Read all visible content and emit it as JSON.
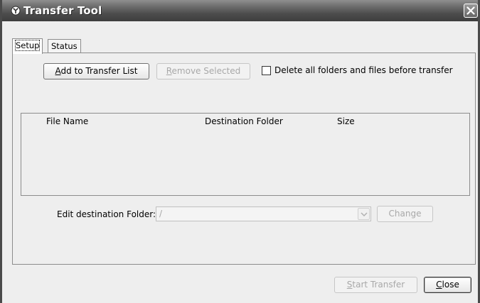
{
  "window": {
    "title": "Transfer Tool"
  },
  "tabs": [
    {
      "label": "Setup",
      "active": true
    },
    {
      "label": "Status",
      "active": false
    }
  ],
  "setup": {
    "add_button": {
      "mnemonic": "A",
      "rest": "dd to Transfer List"
    },
    "remove_button": {
      "mnemonic": "R",
      "rest": "emove Selected"
    },
    "delete_checkbox": {
      "label": "Delete all folders and files before transfer",
      "checked": false
    },
    "table": {
      "columns": [
        "File Name",
        "Destination Folder",
        "Size"
      ],
      "rows": []
    },
    "edit_destination": {
      "label": "Edit destination Folder:",
      "value": "/"
    },
    "change_button": "Change"
  },
  "footer": {
    "start_button": {
      "mnemonic": "S",
      "rest": "tart Transfer"
    },
    "close_button": {
      "mnemonic": "C",
      "rest": "lose"
    }
  },
  "colors": {
    "titlebar": "#4c4c4c",
    "panel_bg": "#eeeeee",
    "disabled_text": "#a8a8a8"
  }
}
